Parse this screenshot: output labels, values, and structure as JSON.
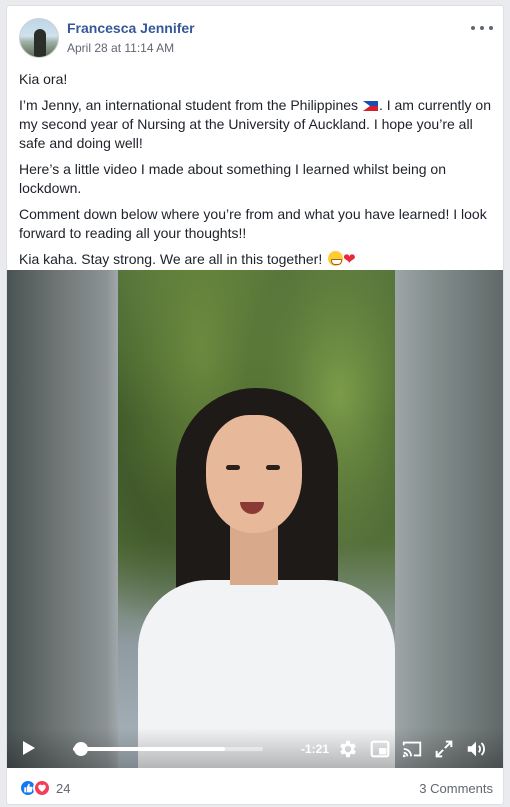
{
  "post": {
    "author": "Francesca Jennifer",
    "timestamp": "April 28 at 11:14 AM",
    "more_icon": "more-dots-icon",
    "paragraphs": {
      "p1": "Kia ora!",
      "p2a": "I’m Jenny, an international student from the Philippines ",
      "p2b": ". I am currently on my second year of Nursing at the University of Auckland. I hope you’re all safe and doing well!",
      "p3": "Here’s a little video I made about something I learned whilst being on lockdown.",
      "p4": "Comment down below where you’re from and what you have learned! I look forward to reading all your thoughts!!",
      "p5": "Kia kaha. Stay strong. We are all in this together! "
    },
    "emojis": [
      "philippines-flag",
      "grinning-face",
      "red-heart"
    ]
  },
  "video": {
    "time_remaining": "-1:21",
    "progress": 0.8,
    "playhead": 0.04,
    "icons": [
      "play-icon",
      "settings-gear-icon",
      "pip-icon",
      "cast-icon",
      "fullscreen-icon",
      "volume-icon"
    ]
  },
  "footer": {
    "reaction_count": "24",
    "comments_label": "3 Comments",
    "reaction_icons": [
      "like-icon",
      "love-icon"
    ]
  },
  "colors": {
    "author_blue": "#365899",
    "like_blue": "#1877f2",
    "love_red": "#f33e58"
  }
}
